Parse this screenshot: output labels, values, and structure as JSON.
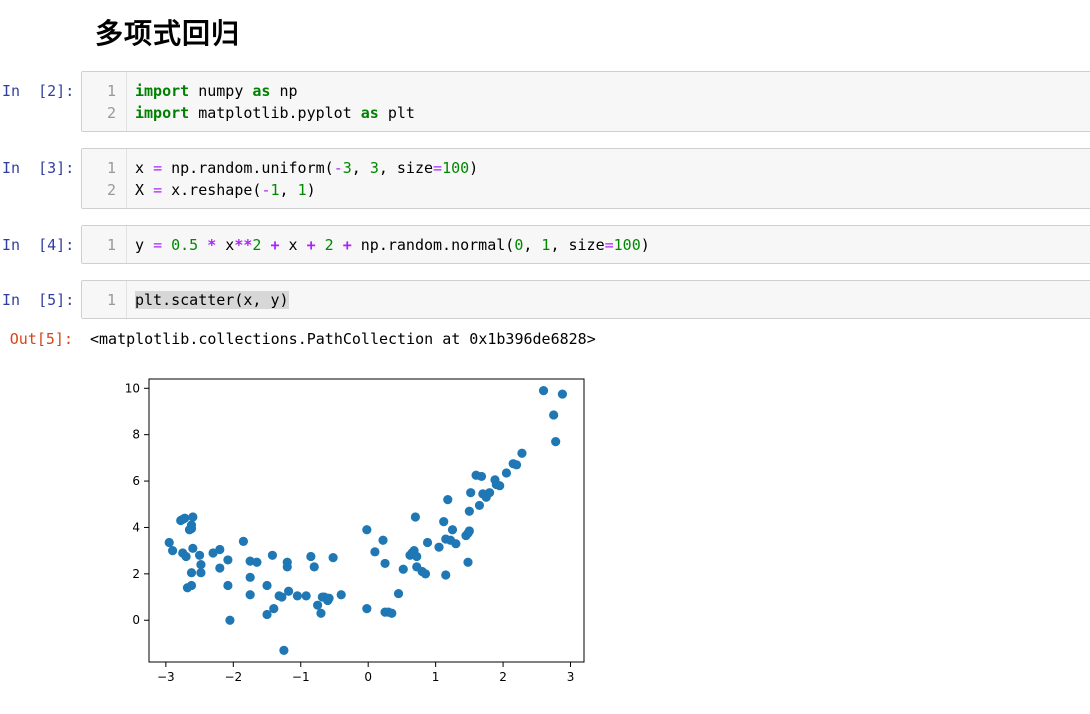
{
  "heading": "多项式回归",
  "cells": [
    {
      "prompt": "In  [2]:",
      "lines": [
        {
          "n": "1",
          "tokens": [
            [
              "kw",
              "import"
            ],
            [
              "t",
              " numpy "
            ],
            [
              "kw",
              "as"
            ],
            [
              "t",
              " np"
            ]
          ]
        },
        {
          "n": "2",
          "tokens": [
            [
              "kw",
              "import"
            ],
            [
              "t",
              " matplotlib.pyplot "
            ],
            [
              "kw",
              "as"
            ],
            [
              "t",
              " plt"
            ]
          ]
        }
      ]
    },
    {
      "prompt": "In  [3]:",
      "lines": [
        {
          "n": "1",
          "tokens": [
            [
              "t",
              "x "
            ],
            [
              "op2",
              "="
            ],
            [
              "t",
              " np.random.uniform("
            ],
            [
              "op2",
              "-"
            ],
            [
              "num",
              "3"
            ],
            [
              "t",
              ", "
            ],
            [
              "num",
              "3"
            ],
            [
              "t",
              ", size"
            ],
            [
              "op2",
              "="
            ],
            [
              "num",
              "100"
            ],
            [
              "t",
              ")"
            ]
          ]
        },
        {
          "n": "2",
          "tokens": [
            [
              "t",
              "X "
            ],
            [
              "op2",
              "="
            ],
            [
              "t",
              " x.reshape("
            ],
            [
              "op2",
              "-"
            ],
            [
              "num",
              "1"
            ],
            [
              "t",
              ", "
            ],
            [
              "num",
              "1"
            ],
            [
              "t",
              ")"
            ]
          ]
        }
      ]
    },
    {
      "prompt": "In  [4]:",
      "lines": [
        {
          "n": "1",
          "tokens": [
            [
              "t",
              "y "
            ],
            [
              "op2",
              "="
            ],
            [
              "t",
              " "
            ],
            [
              "num",
              "0.5"
            ],
            [
              "t",
              " "
            ],
            [
              "op",
              "*"
            ],
            [
              "t",
              " x"
            ],
            [
              "op",
              "**"
            ],
            [
              "num",
              "2"
            ],
            [
              "t",
              " "
            ],
            [
              "op",
              "+"
            ],
            [
              "t",
              " x "
            ],
            [
              "op",
              "+"
            ],
            [
              "t",
              " "
            ],
            [
              "num",
              "2"
            ],
            [
              "t",
              " "
            ],
            [
              "op",
              "+"
            ],
            [
              "t",
              " np.random.normal("
            ],
            [
              "num",
              "0"
            ],
            [
              "t",
              ", "
            ],
            [
              "num",
              "1"
            ],
            [
              "t",
              ", size"
            ],
            [
              "op2",
              "="
            ],
            [
              "num",
              "100"
            ],
            [
              "t",
              ")"
            ]
          ]
        }
      ]
    },
    {
      "prompt": "In  [5]:",
      "lines": [
        {
          "n": "1",
          "tokens": [
            [
              "sel",
              "plt.scatter(x, y)"
            ]
          ]
        }
      ]
    }
  ],
  "output": {
    "prompt": "Out[5]:",
    "text": "<matplotlib.collections.PathCollection at 0x1b396de6828>"
  },
  "chart_data": {
    "type": "scatter",
    "title": "",
    "xlabel": "",
    "ylabel": "",
    "xlim": [
      -3.25,
      3.2
    ],
    "ylim": [
      -1.8,
      10.4
    ],
    "xticks": [
      "−3",
      "−2",
      "−1",
      "0",
      "1",
      "2",
      "3"
    ],
    "xtick_values": [
      -3,
      -2,
      -1,
      0,
      1,
      2,
      3
    ],
    "yticks": [
      "0",
      "2",
      "4",
      "6",
      "8",
      "10"
    ],
    "ytick_values": [
      0,
      2,
      4,
      6,
      8,
      10
    ],
    "marker_color": "#1f77b4",
    "grid": false,
    "points": [
      [
        -2.95,
        3.35
      ],
      [
        -2.9,
        3.0
      ],
      [
        -2.78,
        4.3
      ],
      [
        -2.75,
        4.35
      ],
      [
        -2.72,
        4.4
      ],
      [
        -2.75,
        2.9
      ],
      [
        -2.7,
        2.75
      ],
      [
        -2.68,
        1.4
      ],
      [
        -2.62,
        1.5
      ],
      [
        -2.65,
        3.9
      ],
      [
        -2.62,
        4.1
      ],
      [
        -2.6,
        4.45
      ],
      [
        -2.62,
        3.95
      ],
      [
        -2.6,
        3.1
      ],
      [
        -2.62,
        2.05
      ],
      [
        -2.5,
        2.8
      ],
      [
        -2.48,
        2.4
      ],
      [
        -2.48,
        2.05
      ],
      [
        -2.3,
        2.9
      ],
      [
        -2.2,
        3.05
      ],
      [
        -2.2,
        2.25
      ],
      [
        -2.08,
        2.6
      ],
      [
        -2.08,
        1.5
      ],
      [
        -2.05,
        0.0
      ],
      [
        -1.85,
        3.4
      ],
      [
        -1.75,
        2.55
      ],
      [
        -1.75,
        1.85
      ],
      [
        -1.75,
        1.1
      ],
      [
        -1.65,
        2.5
      ],
      [
        -1.5,
        1.5
      ],
      [
        -1.5,
        0.25
      ],
      [
        -1.42,
        2.8
      ],
      [
        -1.4,
        0.5
      ],
      [
        -1.32,
        1.05
      ],
      [
        -1.28,
        1.0
      ],
      [
        -1.2,
        2.5
      ],
      [
        -1.2,
        2.3
      ],
      [
        -1.18,
        1.25
      ],
      [
        -1.25,
        -1.3
      ],
      [
        -1.05,
        1.05
      ],
      [
        -0.92,
        1.05
      ],
      [
        -0.85,
        2.75
      ],
      [
        -0.8,
        2.3
      ],
      [
        -0.75,
        0.65
      ],
      [
        -0.7,
        0.3
      ],
      [
        -0.68,
        1.0
      ],
      [
        -0.65,
        1.0
      ],
      [
        -0.6,
        0.85
      ],
      [
        -0.58,
        0.95
      ],
      [
        -0.52,
        2.7
      ],
      [
        -0.4,
        1.1
      ],
      [
        -0.02,
        0.5
      ],
      [
        -0.02,
        3.9
      ],
      [
        0.1,
        2.95
      ],
      [
        0.22,
        3.45
      ],
      [
        0.25,
        2.45
      ],
      [
        0.25,
        0.35
      ],
      [
        0.3,
        0.35
      ],
      [
        0.35,
        0.3
      ],
      [
        0.45,
        1.15
      ],
      [
        0.52,
        2.2
      ],
      [
        0.62,
        2.8
      ],
      [
        0.65,
        2.9
      ],
      [
        0.68,
        3.0
      ],
      [
        0.7,
        4.45
      ],
      [
        0.72,
        2.3
      ],
      [
        0.72,
        2.75
      ],
      [
        0.8,
        2.1
      ],
      [
        0.85,
        2.0
      ],
      [
        0.88,
        3.35
      ],
      [
        1.05,
        3.15
      ],
      [
        1.12,
        4.25
      ],
      [
        1.15,
        3.5
      ],
      [
        1.18,
        5.2
      ],
      [
        1.15,
        1.95
      ],
      [
        1.22,
        3.45
      ],
      [
        1.25,
        3.9
      ],
      [
        1.3,
        3.3
      ],
      [
        1.45,
        3.65
      ],
      [
        1.48,
        3.75
      ],
      [
        1.5,
        3.85
      ],
      [
        1.5,
        4.7
      ],
      [
        1.52,
        5.5
      ],
      [
        1.48,
        2.5
      ],
      [
        1.6,
        6.25
      ],
      [
        1.65,
        4.95
      ],
      [
        1.68,
        6.2
      ],
      [
        1.7,
        5.45
      ],
      [
        1.75,
        5.3
      ],
      [
        1.8,
        5.5
      ],
      [
        1.88,
        6.05
      ],
      [
        1.9,
        5.85
      ],
      [
        1.95,
        5.8
      ],
      [
        2.05,
        6.35
      ],
      [
        2.15,
        6.75
      ],
      [
        2.2,
        6.7
      ],
      [
        2.28,
        7.2
      ],
      [
        2.6,
        9.9
      ],
      [
        2.75,
        8.85
      ],
      [
        2.78,
        7.7
      ],
      [
        2.88,
        9.75
      ]
    ]
  }
}
